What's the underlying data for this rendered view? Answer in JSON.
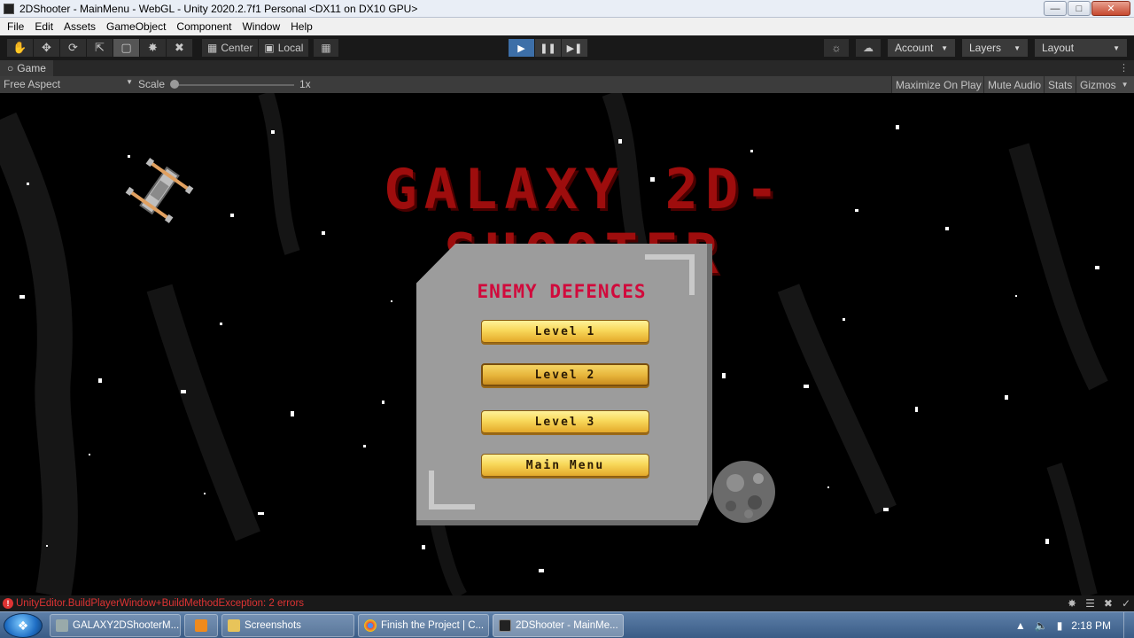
{
  "window": {
    "title": "2DShooter - MainMenu - WebGL - Unity 2020.2.7f1 Personal <DX11 on DX10 GPU>",
    "controls": [
      "minimize",
      "maximize",
      "close"
    ]
  },
  "menubar": {
    "items": [
      "File",
      "Edit",
      "Assets",
      "GameObject",
      "Component",
      "Window",
      "Help"
    ]
  },
  "toolbar": {
    "tools": [
      "hand-icon",
      "move-icon",
      "rotate-icon",
      "scale-icon",
      "rect-icon",
      "transform-icon",
      "custom-tool-icon"
    ],
    "pivot": "Center",
    "space": "Local",
    "account": "Account",
    "layers": "Layers",
    "layout": "Layout"
  },
  "game_tab": {
    "label": "Game"
  },
  "game_toolbar": {
    "aspect": "Free Aspect",
    "scale_label": "Scale",
    "scale_value": "1x",
    "maximize_on_play": "Maximize On Play",
    "mute_audio": "Mute Audio",
    "stats": "Stats",
    "gizmos": "Gizmos"
  },
  "game": {
    "title": "GALAXY 2D-SHOOTER",
    "panel_title": "ENEMY DEFENCES",
    "buttons": [
      "Level 1",
      "Level 2",
      "Level 3",
      "Main Menu"
    ]
  },
  "statusbar": {
    "error": "UnityEditor.BuildPlayerWindow+BuildMethodException: 2 errors"
  },
  "taskbar": {
    "items": [
      "GALAXY2DShooterM...",
      "",
      "Screenshots",
      "Finish the Project | C...",
      "2DShooter - MainMe..."
    ],
    "clock": "2:18 PM"
  },
  "colors": {
    "title_red": "#9e0d0d",
    "panel_title_red": "#d10a3c",
    "button_yellow": "#f8d85a",
    "play_active": "#3d6fa8",
    "error_red": "#dd3333"
  }
}
